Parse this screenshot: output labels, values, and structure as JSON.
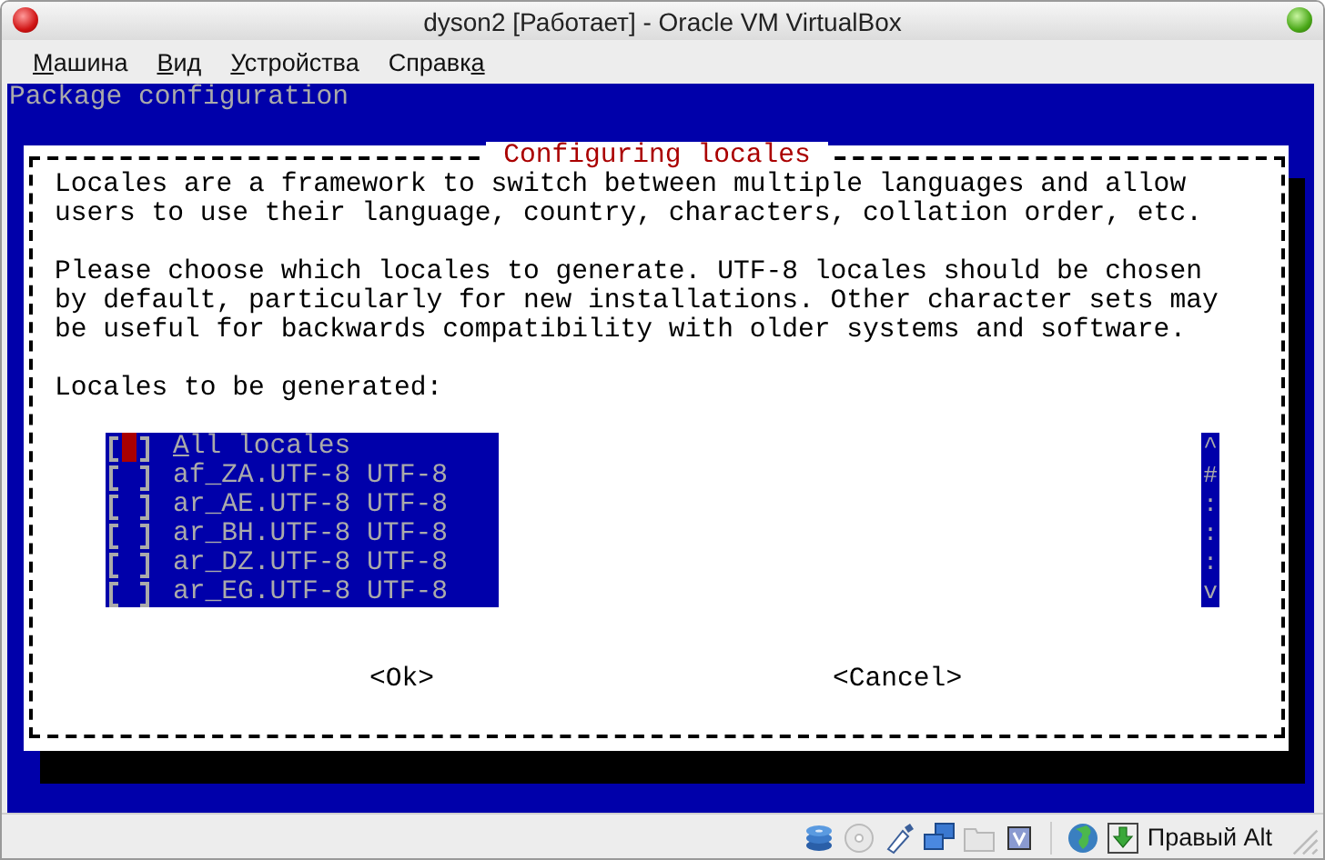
{
  "window": {
    "title": "dyson2 [Работает] - Oracle VM VirtualBox"
  },
  "menu": [
    {
      "key": "М",
      "post": "ашина"
    },
    {
      "key": "В",
      "post": "ид"
    },
    {
      "key": "У",
      "post": "стройства"
    },
    {
      "pre": "Справк",
      "key": "а"
    }
  ],
  "console": {
    "header": "Package configuration",
    "dialog": {
      "title": "Configuring locales",
      "paragraphs": [
        "Locales are a framework to switch between multiple languages and allow\nusers to use their language, country, characters, collation order, etc.",
        "Please choose which locales to generate. UTF-8 locales should be chosen\nby default, particularly for new installations. Other character sets may\nbe useful for backwards compatibility with older systems and software."
      ],
      "list_label": "Locales to be generated:",
      "items": [
        {
          "key": "A",
          "post": "ll locales",
          "checked": false,
          "selected": true
        },
        {
          "pre": "af_ZA.UTF-8 UTF-8",
          "checked": false,
          "selected": false
        },
        {
          "pre": "ar_AE.UTF-8 UTF-8",
          "checked": false,
          "selected": false
        },
        {
          "pre": "ar_BH.UTF-8 UTF-8",
          "checked": false,
          "selected": false
        },
        {
          "pre": "ar_DZ.UTF-8 UTF-8",
          "checked": false,
          "selected": false
        },
        {
          "pre": "ar_EG.UTF-8 UTF-8",
          "checked": false,
          "selected": false
        }
      ],
      "scroll_marks": [
        "^",
        "#",
        ":",
        ":",
        ":",
        "v"
      ],
      "buttons": [
        "<Ok>",
        "<Cancel>"
      ]
    }
  },
  "status_bar": {
    "keyboard_hint": "Правый Alt"
  }
}
